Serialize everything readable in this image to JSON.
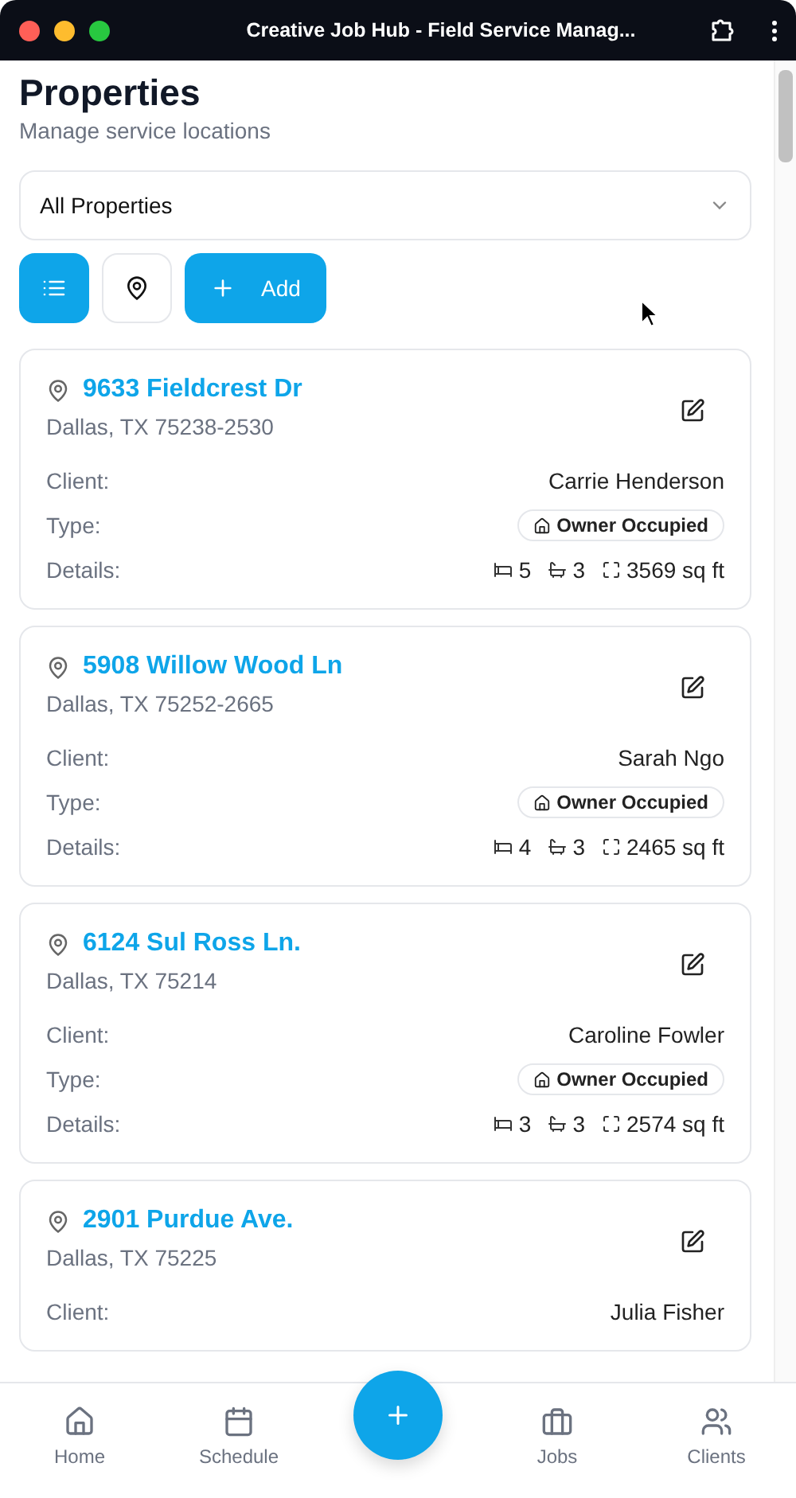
{
  "window": {
    "title": "Creative Job Hub - Field Service Manag..."
  },
  "header": {
    "title": "Properties",
    "subtitle": "Manage service locations"
  },
  "filter": {
    "value": "All Properties"
  },
  "view_toggle": [
    {
      "kind": "list",
      "selected": true
    },
    {
      "kind": "map",
      "selected": false
    }
  ],
  "add_button": {
    "label": "Add"
  },
  "properties": [
    {
      "address": "9633 Fieldcrest Dr",
      "city": "Dallas, TX 75238-2530",
      "client_label": "Client:",
      "client": "Carrie Henderson",
      "type_label": "Type:",
      "type": "Owner Occupied",
      "details_label": "Details:",
      "beds": "5",
      "baths": "3",
      "area": "3569 sq ft"
    },
    {
      "address": "5908 Willow Wood Ln",
      "city": "Dallas, TX 75252-2665",
      "client_label": "Client:",
      "client": "Sarah Ngo",
      "type_label": "Type:",
      "type": "Owner Occupied",
      "details_label": "Details:",
      "beds": "4",
      "baths": "3",
      "area": "2465 sq ft"
    },
    {
      "address": "6124 Sul Ross Ln.",
      "city": "Dallas, TX 75214",
      "client_label": "Client:",
      "client": "Caroline Fowler",
      "type_label": "Type:",
      "type": "Owner Occupied",
      "details_label": "Details:",
      "beds": "3",
      "baths": "3",
      "area": "2574 sq ft"
    },
    {
      "address": "2901 Purdue Ave.",
      "city": "Dallas, TX 75225",
      "client_label": "Client:",
      "client": "Julia Fisher"
    }
  ],
  "bottom_nav": [
    {
      "kind": "home",
      "label": "Home"
    },
    {
      "kind": "schedule",
      "label": "Schedule"
    },
    {
      "kind": "fab"
    },
    {
      "kind": "jobs",
      "label": "Jobs"
    },
    {
      "kind": "clients",
      "label": "Clients"
    }
  ]
}
